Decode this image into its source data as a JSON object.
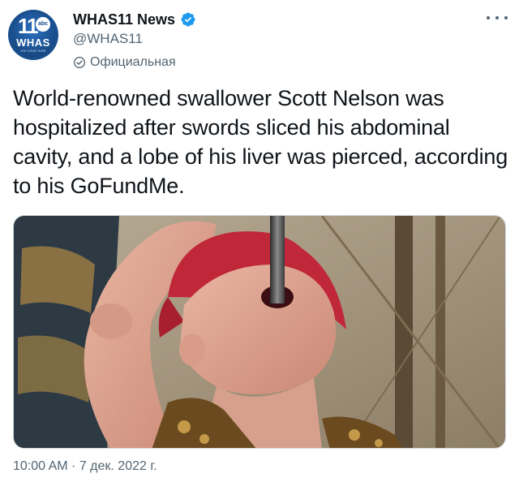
{
  "author": {
    "display_name": "WHAS11 News",
    "handle": "@WHAS11",
    "official_label": "Официальная",
    "avatar": {
      "channel_number": "11",
      "network_badge": "abc",
      "station": "WHAS",
      "tagline": "ON YOUR SIDE"
    },
    "verified_icon": "verified-badge-icon",
    "official_icon": "official-shield-icon"
  },
  "tweet": {
    "text": "World-renowned swallower Scott Nelson was hospitalized after swords sliced his abdominal cavity, and a lobe of his liver was pierced, according to his GoFundMe.",
    "media_description_icon": "photo",
    "timestamp": "10:00 AM · 7 дек. 2022 г."
  },
  "colors": {
    "text_primary": "#0f1419",
    "text_secondary": "#536471",
    "verified_blue": "#1d9bf0",
    "avatar_blue": "#1a4f8e"
  }
}
